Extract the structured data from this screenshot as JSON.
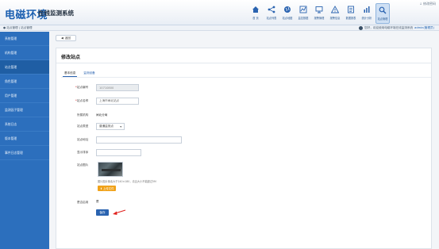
{
  "header": {
    "logo": "电磁环境",
    "subtitle": "在线监测系统",
    "top_right": "↓ 修改密码"
  },
  "nav": [
    {
      "label": "首 页",
      "icon": "home-icon"
    },
    {
      "label": "站点列表",
      "icon": "share-icon"
    },
    {
      "label": "站点地图",
      "icon": "globe-icon"
    },
    {
      "label": "监控数据",
      "icon": "chart-icon"
    },
    {
      "label": "报警管理",
      "icon": "monitor-icon"
    },
    {
      "label": "报警信息",
      "icon": "warning-icon"
    },
    {
      "label": "数据报表",
      "icon": "report-icon"
    },
    {
      "label": "统计分析",
      "icon": "stats-icon"
    },
    {
      "label": "站点管理",
      "icon": "search-icon"
    }
  ],
  "subbar": {
    "breadcrumb": "● 站点管理 | 站点管理",
    "user_text": "您好，欢迎使用电磁环境在线监测系统",
    "user_name": "admin(管理员)"
  },
  "sidebar": [
    "系统管理",
    "机构管理",
    "站点管理",
    "角色管理",
    "用户管理",
    "监测因子管理",
    "系统日志",
    "版本管理",
    "事件日志管理"
  ],
  "main": {
    "back_label": "返回",
    "card_title": "修改站点",
    "tabs": [
      "基本信息",
      "监测设备"
    ],
    "form": {
      "code_label": "站点编号",
      "code_value": "10710800",
      "name_label": "站点名称",
      "name_placeholder": "上海市闸北站点",
      "org_label": "所属机构",
      "org_value": "闸北分局",
      "type_label": "站点类型",
      "type_value": "普通监测点",
      "addr_label": "站点地址",
      "sort_label": "显示排序",
      "image_label": "站点图片",
      "image_hint": "图片图片像素大于240×180，请且大小不能超过5M",
      "upload_label": "上传文件",
      "active_label": "是否启用",
      "active_value": "是",
      "save_label": "保存"
    }
  },
  "colors": {
    "sidebar": "#2c6fbd",
    "accent": "#2a63b0",
    "upload": "#f0a21a",
    "arrow": "#e0201c"
  }
}
